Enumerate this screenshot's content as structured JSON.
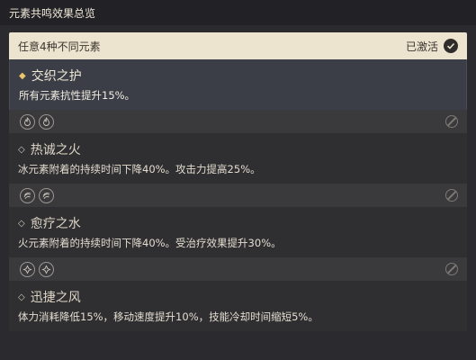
{
  "window": {
    "title": "元素共鸣效果总览"
  },
  "active_group": {
    "condition": "任意4种不同元素",
    "status": "已激活",
    "effect": {
      "name": "交织之护",
      "description": "所有元素抗性提升15%。"
    }
  },
  "resonances": [
    {
      "icons": [
        "pyro-icon",
        "pyro-icon"
      ],
      "name": "热诚之火",
      "description": "冰元素附着的持续时间下降40%。攻击力提高25%。"
    },
    {
      "icons": [
        "hydro-icon",
        "hydro-icon"
      ],
      "name": "愈疗之水",
      "description": "火元素附着的持续时间下降40%。受治疗效果提升30%。"
    },
    {
      "icons": [
        "anemo-icon",
        "anemo-icon"
      ],
      "name": "迅捷之风",
      "description": "体力消耗降低15%，移动速度提升10%，技能冷却时间缩短5%。"
    }
  ],
  "colors": {
    "header_bg": "#ece4cf",
    "active_bg": "#3b3d47",
    "panel_bg": "#2f2e31",
    "accent": "#e8c46a"
  }
}
